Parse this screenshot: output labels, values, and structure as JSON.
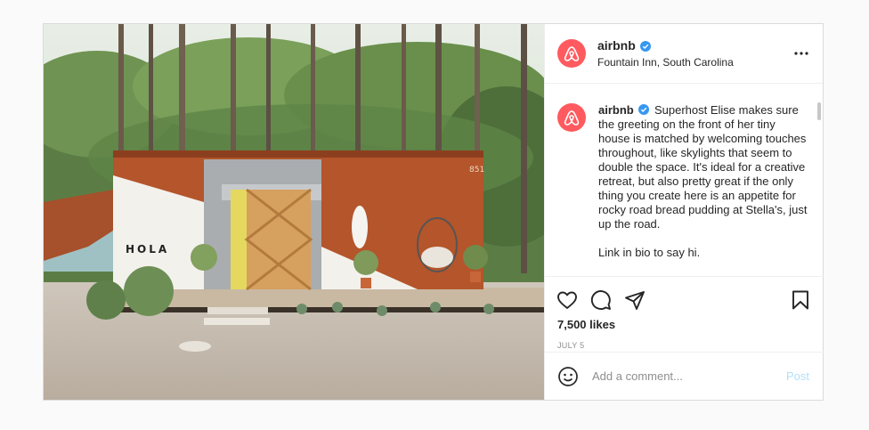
{
  "header": {
    "username": "airbnb",
    "location": "Fountain Inn, South Carolina"
  },
  "caption": {
    "username": "airbnb",
    "text": "Superhost Elise makes sure the greeting on the front of her tiny house is matched by welcoming touches throughout, like skylights that seem to double the space. It's ideal for a creative retreat, but also pretty great if the only thing you create here is an appetite for rocky road bread pudding at Stella's, just up the road.",
    "link_line": "Link in bio to say hi."
  },
  "photo": {
    "sign_text": "HOLA",
    "house_number": "851"
  },
  "engagement": {
    "likes": "7,500 likes",
    "date": "JULY 5"
  },
  "comment": {
    "placeholder": "Add a comment...",
    "post_label": "Post"
  },
  "icons": {
    "avatar": "airbnb-logo-icon",
    "verified": "verified-badge-icon",
    "more": "more-options-icon",
    "like": "heart-icon",
    "comment": "comment-icon",
    "share": "share-icon",
    "save": "bookmark-icon",
    "emoji": "emoji-icon"
  },
  "colors": {
    "brand": "#ff5a5f",
    "verified": "#3897f0",
    "post_disabled": "#b2dffc",
    "muted": "#8e8e8e"
  }
}
